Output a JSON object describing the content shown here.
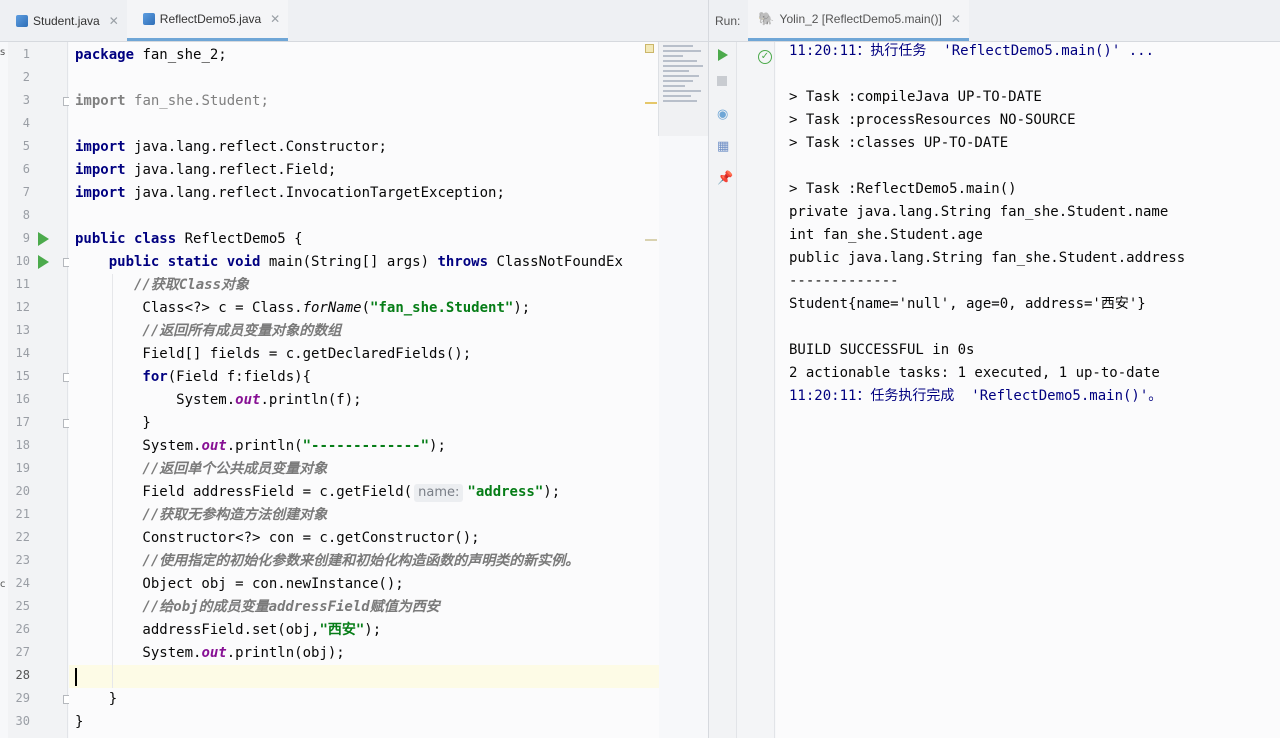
{
  "editor_tabs": [
    {
      "label": "Student.java",
      "active": false
    },
    {
      "label": "ReflectDemo5.java",
      "active": true
    }
  ],
  "run_panel": {
    "label": "Run:",
    "tab_label": "Yolin_2 [ReflectDemo5.main()]"
  },
  "current_line": 28,
  "edge_letters": [
    "s",
    "c"
  ],
  "code_lines": [
    {
      "n": 1,
      "segments": [
        {
          "t": "package ",
          "c": "kw"
        },
        {
          "t": "fan_she_2;",
          "c": ""
        }
      ]
    },
    {
      "n": 2,
      "segments": []
    },
    {
      "n": 3,
      "segments": [
        {
          "t": "import ",
          "c": "kw gray"
        },
        {
          "t": "fan_she.Student;",
          "c": "gray"
        }
      ]
    },
    {
      "n": 4,
      "segments": []
    },
    {
      "n": 5,
      "segments": [
        {
          "t": "import ",
          "c": "kw"
        },
        {
          "t": "java.lang.reflect.Constructor;",
          "c": ""
        }
      ]
    },
    {
      "n": 6,
      "segments": [
        {
          "t": "import ",
          "c": "kw"
        },
        {
          "t": "java.lang.reflect.Field;",
          "c": ""
        }
      ]
    },
    {
      "n": 7,
      "segments": [
        {
          "t": "import ",
          "c": "kw"
        },
        {
          "t": "java.lang.reflect.InvocationTargetException;",
          "c": ""
        }
      ]
    },
    {
      "n": 8,
      "segments": []
    },
    {
      "n": 9,
      "segments": [
        {
          "t": "public class ",
          "c": "kw"
        },
        {
          "t": "ReflectDemo5 {",
          "c": ""
        }
      ]
    },
    {
      "n": 10,
      "segments": [
        {
          "t": "    public static void ",
          "c": "kw"
        },
        {
          "t": "main(String[] args) ",
          "c": ""
        },
        {
          "t": "throws ",
          "c": "kw"
        },
        {
          "t": "ClassNotFoundEx",
          "c": ""
        }
      ]
    },
    {
      "n": 11,
      "segments": [
        {
          "t": "       //获取Class对象",
          "c": "cmt-b"
        }
      ]
    },
    {
      "n": 12,
      "segments": [
        {
          "t": "        Class<?> c = Class.",
          "c": ""
        },
        {
          "t": "forName",
          "c": "ital"
        },
        {
          "t": "(",
          "c": ""
        },
        {
          "t": "\"fan_she.Student\"",
          "c": "str"
        },
        {
          "t": ");",
          "c": ""
        }
      ]
    },
    {
      "n": 13,
      "segments": [
        {
          "t": "        //返回所有成员变量对象的数组",
          "c": "cmt-b"
        }
      ]
    },
    {
      "n": 14,
      "segments": [
        {
          "t": "        Field[] fields = c.getDeclaredFields();",
          "c": ""
        }
      ]
    },
    {
      "n": 15,
      "segments": [
        {
          "t": "        for",
          "c": "kw"
        },
        {
          "t": "(Field f:fields){",
          "c": ""
        }
      ]
    },
    {
      "n": 16,
      "segments": [
        {
          "t": "            System.",
          "c": ""
        },
        {
          "t": "out",
          "c": "fld"
        },
        {
          "t": ".println(f);",
          "c": ""
        }
      ]
    },
    {
      "n": 17,
      "segments": [
        {
          "t": "        }",
          "c": ""
        }
      ]
    },
    {
      "n": 18,
      "segments": [
        {
          "t": "        System.",
          "c": ""
        },
        {
          "t": "out",
          "c": "fld"
        },
        {
          "t": ".println(",
          "c": ""
        },
        {
          "t": "\"-------------\"",
          "c": "str"
        },
        {
          "t": ");",
          "c": ""
        }
      ]
    },
    {
      "n": 19,
      "segments": [
        {
          "t": "        //返回单个公共成员变量对象",
          "c": "cmt-b"
        }
      ]
    },
    {
      "n": 20,
      "segments": [
        {
          "t": "        Field addressField = c.getField(",
          "c": ""
        },
        {
          "t": "name:",
          "c": "hint"
        },
        {
          "t": "\"address\"",
          "c": "str"
        },
        {
          "t": ");",
          "c": ""
        }
      ]
    },
    {
      "n": 21,
      "segments": [
        {
          "t": "        //获取无参构造方法创建对象",
          "c": "cmt-b"
        }
      ]
    },
    {
      "n": 22,
      "segments": [
        {
          "t": "        Constructor<?> con = c.getConstructor();",
          "c": ""
        }
      ]
    },
    {
      "n": 23,
      "segments": [
        {
          "t": "        //使用指定的初始化参数来创建和初始化构造函数的声明类的新实例。",
          "c": "cmt-b"
        }
      ]
    },
    {
      "n": 24,
      "segments": [
        {
          "t": "        Object obj = con.newInstance();",
          "c": ""
        }
      ]
    },
    {
      "n": 25,
      "segments": [
        {
          "t": "        //给obj的成员变量addressField赋值为西安",
          "c": "cmt-b"
        }
      ]
    },
    {
      "n": 26,
      "segments": [
        {
          "t": "        addressField.set(obj,",
          "c": ""
        },
        {
          "t": "\"西安\"",
          "c": "str"
        },
        {
          "t": ");",
          "c": ""
        }
      ]
    },
    {
      "n": 27,
      "segments": [
        {
          "t": "        System.",
          "c": ""
        },
        {
          "t": "out",
          "c": "fld"
        },
        {
          "t": ".println(obj);",
          "c": ""
        }
      ]
    },
    {
      "n": 28,
      "segments": []
    },
    {
      "n": 29,
      "segments": [
        {
          "t": "    }",
          "c": ""
        }
      ]
    },
    {
      "n": 30,
      "segments": [
        {
          "t": "}",
          "c": ""
        }
      ]
    }
  ],
  "run_arrow_lines": [
    9,
    10
  ],
  "fold_lines": [
    3,
    10,
    15,
    17,
    29
  ],
  "console_lines": [
    {
      "text": "11:20:11：执行任务  'ReflectDemo5.main()' ...",
      "kind": "status"
    },
    {
      "text": "",
      "kind": ""
    },
    {
      "text": "> Task :compileJava UP-TO-DATE",
      "kind": ""
    },
    {
      "text": "> Task :processResources NO-SOURCE",
      "kind": ""
    },
    {
      "text": "> Task :classes UP-TO-DATE",
      "kind": ""
    },
    {
      "text": "",
      "kind": ""
    },
    {
      "text": "> Task :ReflectDemo5.main()",
      "kind": ""
    },
    {
      "text": "private java.lang.String fan_she.Student.name",
      "kind": ""
    },
    {
      "text": "int fan_she.Student.age",
      "kind": ""
    },
    {
      "text": "public java.lang.String fan_she.Student.address",
      "kind": ""
    },
    {
      "text": "-------------",
      "kind": ""
    },
    {
      "text": "Student{name='null', age=0, address='西安'}",
      "kind": ""
    },
    {
      "text": "",
      "kind": ""
    },
    {
      "text": "BUILD SUCCESSFUL in 0s",
      "kind": ""
    },
    {
      "text": "2 actionable tasks: 1 executed, 1 up-to-date",
      "kind": ""
    },
    {
      "text": "11:20:11：任务执行完成  'ReflectDemo5.main()'。",
      "kind": "status"
    }
  ],
  "icons": {
    "java_file": "java-class-icon",
    "close": "close-icon",
    "gradle": "gradle-elephant-icon",
    "run": "play-icon",
    "stop": "stop-icon",
    "view": "eye-icon",
    "layout": "grid-icon",
    "pin": "pin-icon",
    "success": "check-icon"
  },
  "colors": {
    "keyword": "#000080",
    "string": "#067d17",
    "comment": "#8c8c8c",
    "run_green": "#4caa4c",
    "active_tab_underline": "#6fa6d6",
    "current_line": "#fdfbe6"
  }
}
